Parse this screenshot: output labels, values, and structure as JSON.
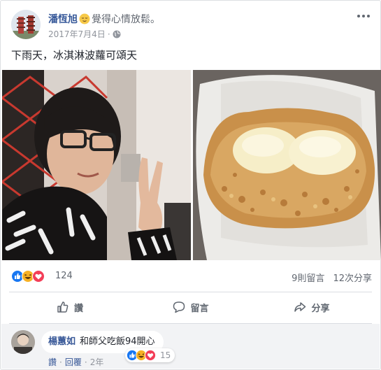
{
  "post": {
    "author": "潘恆旭",
    "feeling": "覺得心情放鬆。",
    "date": "2017年7月4日",
    "dot": "·",
    "text": "下雨天，冰淇淋波蘿可頌天"
  },
  "stats": {
    "reaction_count": "124",
    "comments": "9則留言",
    "shares": "12次分享"
  },
  "actions": {
    "like": "讚",
    "comment": "留言",
    "share": "分享"
  },
  "comment": {
    "author": "楊蕙如",
    "text": "和師父吃飯94開心",
    "reaction_count": "15",
    "like_link": "讚",
    "reply_link": "回覆",
    "sep": "·",
    "time": "2年"
  },
  "colors": {
    "link": "#365899",
    "like_blue": "#1877f2",
    "love_red": "#f33e58",
    "haha_yellow": "#f7b125"
  }
}
